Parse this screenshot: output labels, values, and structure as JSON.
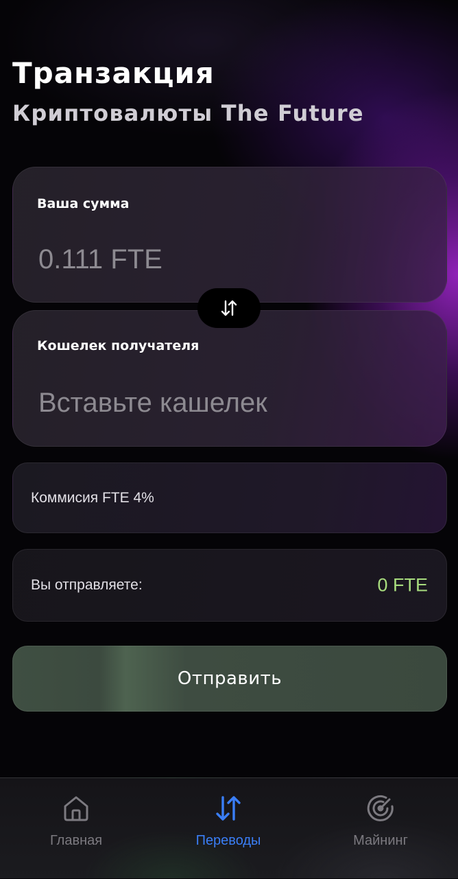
{
  "header": {
    "title": "Транзакция",
    "subtitle": "Криптовалюты The Future"
  },
  "amount_card": {
    "label": "Ваша сумма",
    "placeholder": "0.111 FTE"
  },
  "wallet_card": {
    "label": "Кошелек получателя",
    "placeholder": "Вставьте кашелек"
  },
  "swap": {
    "icon": "swap-vertical-icon"
  },
  "commission": {
    "text": "Коммисия FTE 4%"
  },
  "send_summary": {
    "label": "Вы отправляете:",
    "value": "0 FTE",
    "value_color": "#a8dc7e"
  },
  "submit": {
    "label": "Отправить"
  },
  "nav": {
    "items": [
      {
        "label": "Главная",
        "icon": "home-icon",
        "active": false
      },
      {
        "label": "Переводы",
        "icon": "transfer-icon",
        "active": true
      },
      {
        "label": "Майнинг",
        "icon": "radar-icon",
        "active": false
      }
    ],
    "active_color": "#3a7ef6",
    "inactive_color": "#7c7a80"
  }
}
